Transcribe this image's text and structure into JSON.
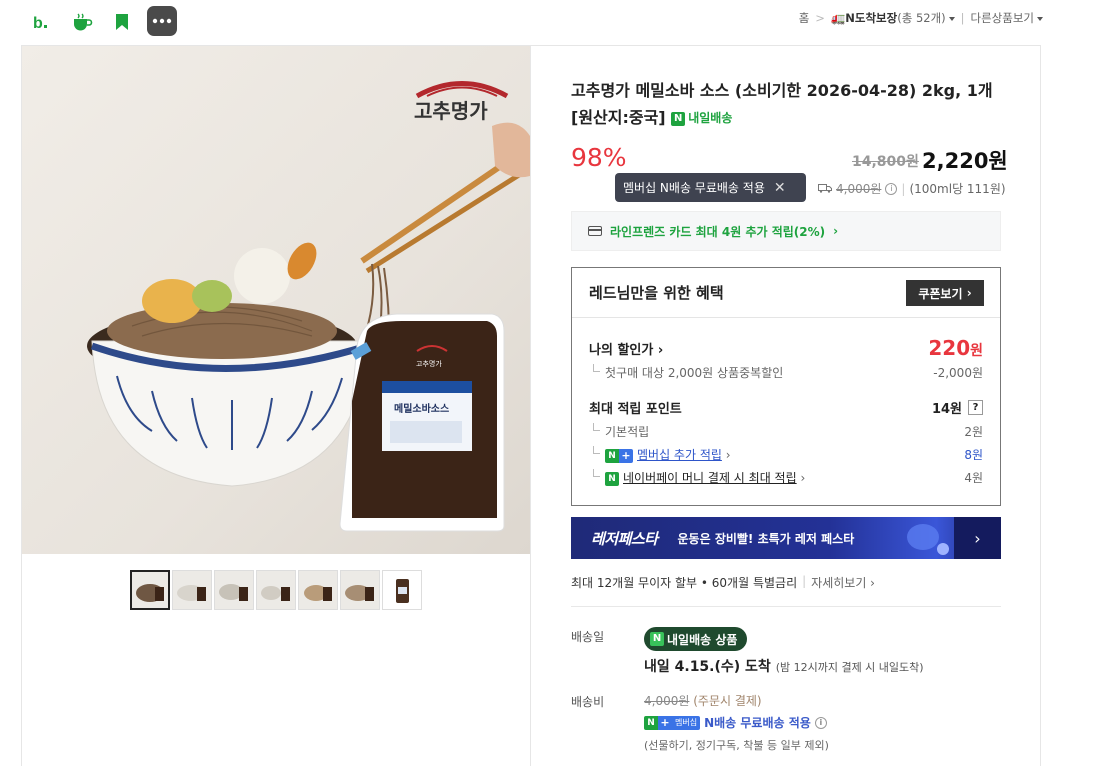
{
  "topbar": {
    "icons": [
      "blog-icon",
      "cafe-icon",
      "bookmark-icon",
      "more-icon"
    ],
    "breadcrumb": {
      "home": "홈",
      "sep": ">",
      "category_label": "N도착보장",
      "category_count": "(총 52개)",
      "other": "다른상품보기"
    }
  },
  "gallery": {
    "brand_text": "고추명가",
    "package_label": "메밀소바소스",
    "thumbnail_count": 7
  },
  "product": {
    "title": "고추명가 메밀소바 소스 (소비기한 2026-04-28) 2kg, 1개 [원산지:중국]",
    "delivery_badge": "내일배송",
    "discount": "98%",
    "original_price": "14,800원",
    "price": "2,220원",
    "tooltip": "멤버십 N배송 무료배송 적용",
    "ship_fee_strike": "4,000원",
    "unit_price": "(100ml당 111원)"
  },
  "card_promo": "라인프렌즈 카드 최대 4원 추가 적립(2%)",
  "benefit": {
    "title": "레드님만을 위한 혜택",
    "coupon_button": "쿠폰보기",
    "my_discount_label": "나의 할인가",
    "my_discount_value": "220",
    "my_discount_unit": "원",
    "first_purchase": "첫구매 대상 2,000원 상품중복할인",
    "first_purchase_value": "-2,000원",
    "max_points_label": "최대 적립 포인트",
    "max_points_value": "14원",
    "basic_points": "기본적립",
    "basic_points_value": "2원",
    "membership_points": "멤버십 추가 적립",
    "membership_points_value": "8원",
    "pay_points": "네이버페이 머니 결제 시 최대 적립",
    "pay_points_value": "4원"
  },
  "banner": {
    "logo": "레저페스타",
    "text": "운동은 장비빨! 초특가 레저 페스타"
  },
  "installment": {
    "text": "최대 12개월 무이자 할부 • 60개월 특별금리",
    "more": "자세히보기"
  },
  "delivery": {
    "date_label": "배송일",
    "pill": "내일배송 상품",
    "arrival": "내일 4.15.(수) 도착",
    "arrival_note": "(밤 12시까지 결제 시 내일도착)",
    "fee_label": "배송비",
    "fee_strike": "4,000원",
    "fee_note": "(주문시 결제)",
    "free_text": "N배송 무료배송 적용",
    "membership_tag": "멤버십",
    "exclusion": "(선물하기, 정기구독, 착불 등 일부 제외)"
  },
  "colors": {
    "accent_red": "#e8363e",
    "naver_green": "#1ea33f",
    "link_blue": "#2e55c9"
  }
}
